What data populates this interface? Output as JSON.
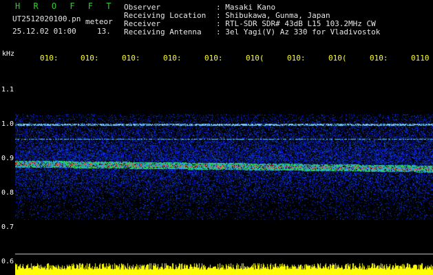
{
  "header": {
    "brand": "H R O F F T",
    "filename": "UT2512020100.pn",
    "meteor_label": "meteor",
    "datetime": "25.12.02 01:00",
    "count": "13."
  },
  "info": [
    {
      "label": "Observer",
      "value": ": Masaki Kano"
    },
    {
      "label": "Receiving Location",
      "value": ": Shibukawa, Gunma, Japan"
    },
    {
      "label": "Receiver",
      "value": ": RTL-SDR SDR# 43dB L15 103.2MHz CW"
    },
    {
      "label": "Receiving Antenna",
      "value": ": 3el Yagi(V) Az 330 for Vladivostok"
    }
  ],
  "axis": {
    "unit": "kHz",
    "y_ticks": [
      "1.1",
      "1.0",
      "0.9",
      "0.8",
      "0.7",
      "0.6"
    ],
    "x_ticks": [
      "010:",
      "010:",
      "010:",
      "010:",
      "010:",
      "010(",
      "010:",
      "010(",
      "010:",
      "0110"
    ]
  },
  "colors": {
    "background": "#000000",
    "text": "#e8e8e8",
    "brand": "#33cc33",
    "tick_time": "#ffff22",
    "noise_floor": "#ffff00",
    "band_low": "#1a3cff",
    "band_high": "#ff3030"
  }
}
